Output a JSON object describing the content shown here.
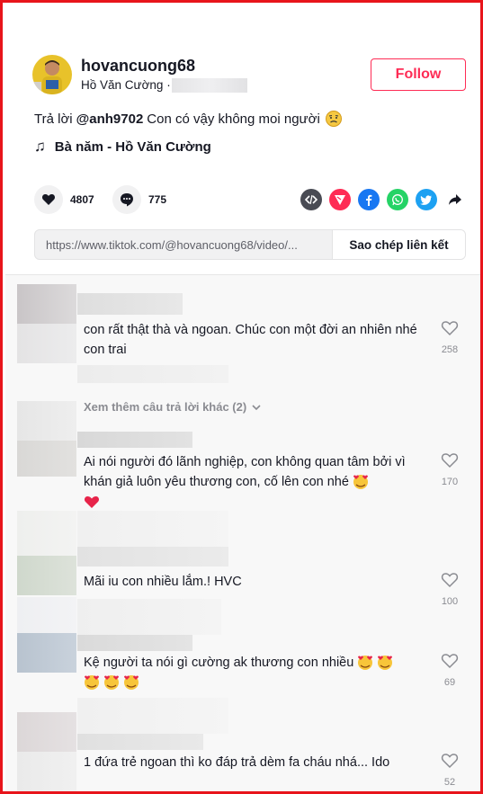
{
  "header": {
    "username": "hovancuong68",
    "nickname": "Hồ Văn Cường",
    "separator": "·",
    "follow_label": "Follow"
  },
  "caption": {
    "prefix": "Trả lời",
    "mention": "@anh9702",
    "text": "Con có vậy không moi người"
  },
  "music": {
    "title": "Bà năm - Hồ Văn Cường"
  },
  "actions": {
    "likes": "4807",
    "comments": "775"
  },
  "share_icons": [
    "embed-icon",
    "send-icon",
    "facebook-icon",
    "whatsapp-icon",
    "twitter-icon",
    "share-arrow-icon"
  ],
  "link": {
    "url": "https://www.tiktok.com/@hovancuong68/video/...",
    "copy_label": "Sao chép liên kết"
  },
  "comments": [
    {
      "text": "con rất thật thà và ngoan. Chúc con một đời an nhiên nhé con trai",
      "likes": "258"
    },
    {
      "more_replies": "Xem thêm câu trả lời khác (2)"
    },
    {
      "text": "Ai nói người đó lãnh nghiệp, con không quan tâm bởi vì khán giả luôn yêu thương con, cố lên con nhé",
      "likes": "170"
    },
    {
      "text": "Mãi iu con nhiều lắm.! HVC",
      "likes": "100"
    },
    {
      "text": "Kệ người ta nói gì cường ak thương con nhiều",
      "likes": "69"
    },
    {
      "text": "1 đứa trẻ ngoan thì ko đáp trả dèm fa cháu nhá... Ido",
      "likes": "52"
    }
  ],
  "colors": {
    "accent": "#fe2c55",
    "frame": "#e8141b"
  }
}
